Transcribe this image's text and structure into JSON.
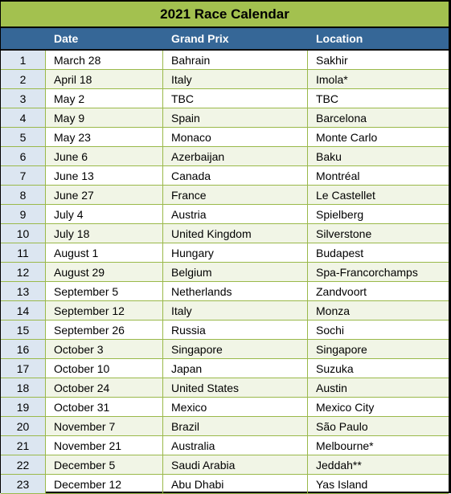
{
  "title": "2021 Race Calendar",
  "headers": [
    "",
    "Date",
    "Grand Prix",
    "Location"
  ],
  "rows": [
    [
      "1",
      "March 28",
      "Bahrain",
      "Sakhir"
    ],
    [
      "2",
      "April 18",
      "Italy",
      "Imola*"
    ],
    [
      "3",
      "May 2",
      "TBC",
      "TBC"
    ],
    [
      "4",
      "May 9",
      "Spain",
      "Barcelona"
    ],
    [
      "5",
      "May 23",
      "Monaco",
      "Monte Carlo"
    ],
    [
      "6",
      "June 6",
      "Azerbaijan",
      "Baku"
    ],
    [
      "7",
      "June 13",
      "Canada",
      "Montréal"
    ],
    [
      "8",
      "June 27",
      "France",
      "Le Castellet"
    ],
    [
      "9",
      "July 4",
      "Austria",
      "Spielberg"
    ],
    [
      "10",
      "July 18",
      "United Kingdom",
      "Silverstone"
    ],
    [
      "11",
      "August 1",
      "Hungary",
      "Budapest"
    ],
    [
      "12",
      "August 29",
      "Belgium",
      "Spa-Francorchamps"
    ],
    [
      "13",
      "September 5",
      "Netherlands",
      "Zandvoort"
    ],
    [
      "14",
      "September 12",
      "Italy",
      "Monza"
    ],
    [
      "15",
      "September 26",
      "Russia",
      "Sochi"
    ],
    [
      "16",
      "October 3",
      "Singapore",
      "Singapore"
    ],
    [
      "17",
      "October 10",
      "Japan",
      "Suzuka"
    ],
    [
      "18",
      "October 24",
      "United States",
      "Austin"
    ],
    [
      "19",
      "October 31",
      "Mexico",
      "Mexico City"
    ],
    [
      "20",
      "November 7",
      "Brazil",
      "São Paulo"
    ],
    [
      "21",
      "November 21",
      "Australia",
      "Melbourne*"
    ],
    [
      "22",
      "December 5",
      "Saudi Arabia",
      "Jeddah**"
    ],
    [
      "23",
      "December 12",
      "Abu Dhabi",
      "Yas Island"
    ]
  ],
  "colors": {
    "title_bg": "#a3c14f",
    "header_bg": "#366797",
    "index_bg": "#dce6f1",
    "grid": "#9ab94a",
    "alt_row": "#f1f5e6"
  }
}
